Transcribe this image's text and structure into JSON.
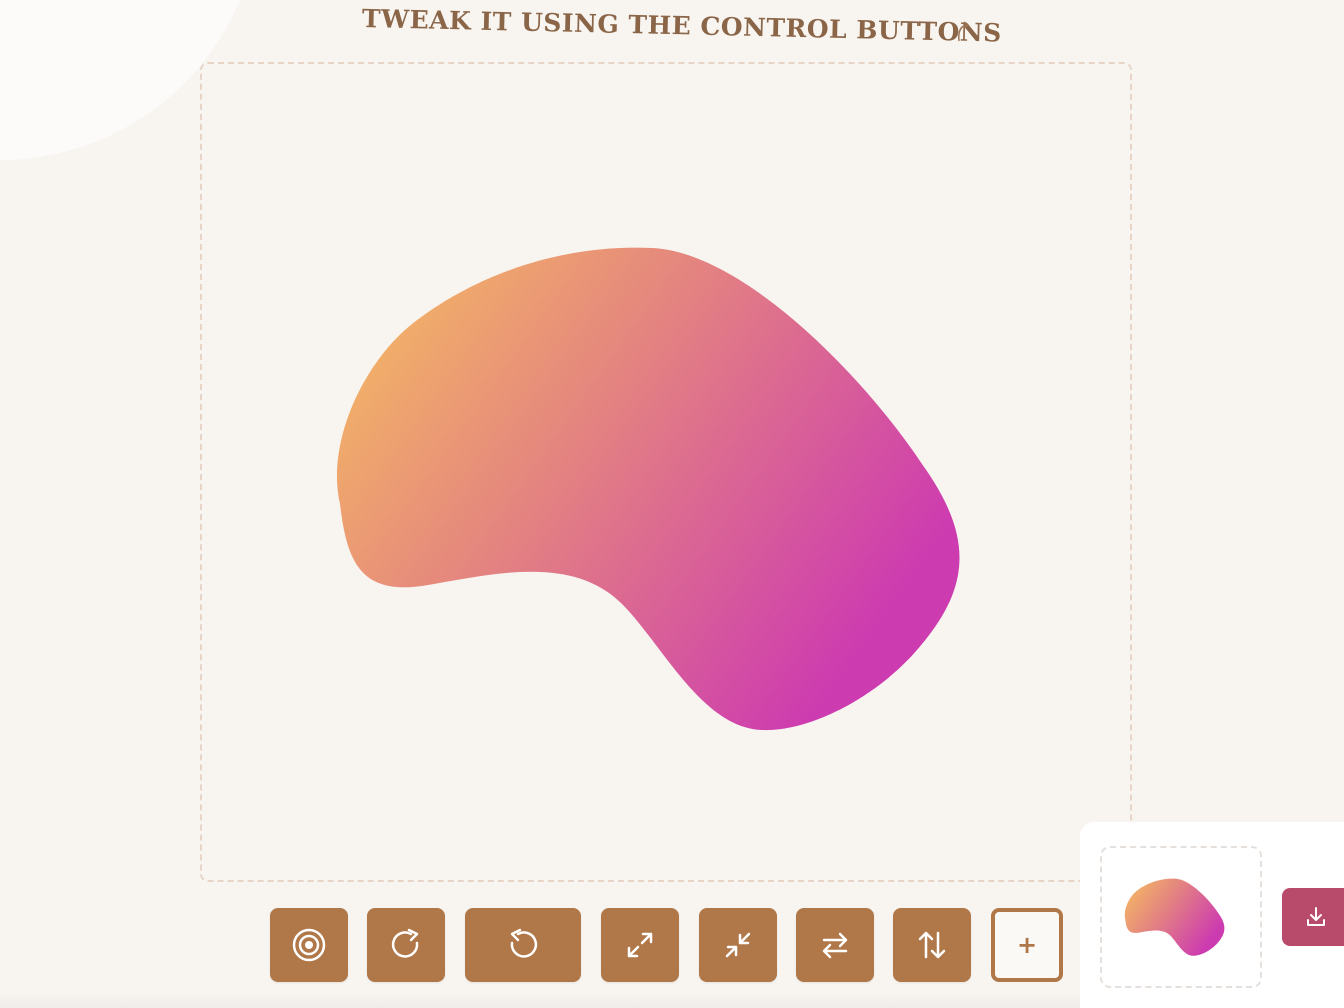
{
  "header": {
    "instruction_text": "TWEAK IT USING THE CONTROL BUTTONS",
    "arrow_icon": "curved-arrow-icon"
  },
  "editor": {
    "shape": "blob",
    "gradient": {
      "start_color": "#f7c05f",
      "end_color": "#cd3bb0"
    }
  },
  "toolbar": {
    "buttons": [
      {
        "name": "randomness-button",
        "icon": "target-icon"
      },
      {
        "name": "redo-button",
        "icon": "redo-icon"
      },
      {
        "name": "undo-button",
        "icon": "undo-icon"
      },
      {
        "name": "expand-button",
        "icon": "expand-icon"
      },
      {
        "name": "shrink-button",
        "icon": "shrink-icon"
      },
      {
        "name": "flip-horizontal-button",
        "icon": "swap-horizontal-icon"
      },
      {
        "name": "flip-vertical-button",
        "icon": "swap-vertical-icon"
      }
    ],
    "add_label": "+"
  },
  "preview": {
    "download_label": "",
    "download_icon": "download-icon"
  },
  "colors": {
    "button_brown": "#b07748",
    "download_pink": "#b84a6c",
    "background": "#f8f5f1",
    "heading": "#8a6547"
  }
}
